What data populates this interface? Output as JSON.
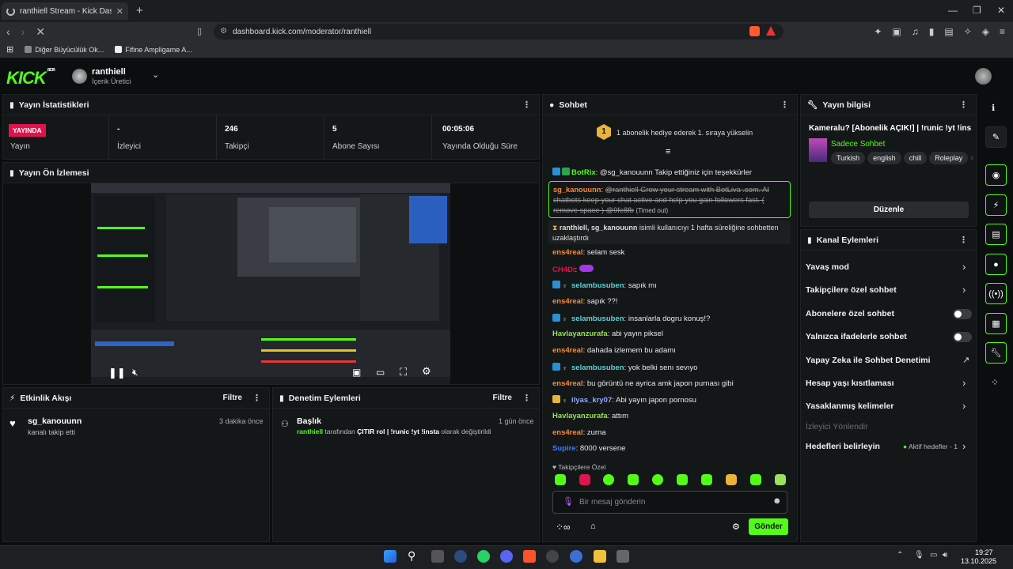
{
  "browser": {
    "tab_title": "ranthiell Stream - Kick Dashboard",
    "url": "dashboard.kick.com/moderator/ranthiell",
    "bookmarks": [
      "Diğer Büyücülük Ok...",
      "Fifine Ampligame A..."
    ]
  },
  "header": {
    "logo": "KICK",
    "logo_beta": "BETA",
    "user_name": "ranthiell",
    "user_role": "İçerik Üretici"
  },
  "stats": {
    "title": "Yayın İstatistikleri",
    "live_badge": "YAYINDA",
    "items": [
      {
        "value": "",
        "label": "Yayın"
      },
      {
        "value": "-",
        "label": "İzleyici"
      },
      {
        "value": "246",
        "label": "Takipçi"
      },
      {
        "value": "5",
        "label": "Abone Sayısı"
      },
      {
        "value": "00:05:06",
        "label": "Yayında Olduğu Süre"
      }
    ]
  },
  "preview": {
    "title": "Yayın Ön İzlemesi"
  },
  "activity": {
    "title": "Etkinlik Akışı",
    "filter": "Filtre",
    "items": [
      {
        "user": "sg_kanouunn",
        "text": "kanalı takip etti",
        "time": "3 dakika önce"
      }
    ]
  },
  "moderation": {
    "title": "Denetim Eylemleri",
    "filter": "Filtre",
    "items": [
      {
        "heading": "Başlık",
        "time": "1 gün önce",
        "actor": "ranthiell",
        "mid": "tarafından",
        "value": "ÇITIR rol | !runic !yt !insta",
        "suffix": "olarak değiştirildi"
      }
    ]
  },
  "chat": {
    "title": "Sohbet",
    "pinned": "1 abonelik hediye ederek 1. sıraya yükselin",
    "pinned_rank": "1",
    "messages": [
      {
        "name": "BotRix",
        "color": "#53fc18",
        "text": "@sg_kanouunn Takip ettiğiniz için teşekkürler"
      },
      {
        "name": "ens4real",
        "color": "#f28b3c",
        "text": "selam sesk"
      },
      {
        "name": "CH4Di",
        "color": "#e0134c",
        "text": ""
      },
      {
        "name": "selambusuben",
        "color": "#5fd0d6",
        "text": "sapık mı"
      },
      {
        "name": "ens4real",
        "color": "#f28b3c",
        "text": "sapık ??!"
      },
      {
        "name": "selambusuben",
        "color": "#5fd0d6",
        "text": "insanlarla dogru konuş!?"
      },
      {
        "name": "Havlayanzurafa",
        "color": "#9be15d",
        "text": "abi yayın piksel"
      },
      {
        "name": "ens4real",
        "color": "#f28b3c",
        "text": "dahada izlemem bu adamı"
      },
      {
        "name": "selambusuben",
        "color": "#5fd0d6",
        "text": "yok belki senı sevıyo"
      },
      {
        "name": "ens4real",
        "color": "#f28b3c",
        "text": "bu görüntü ne ayrica amk japon purnası gibi"
      },
      {
        "name": "ilyas_kry07",
        "color": "#8fa8ff",
        "text": "Abi yayın japon pornosu"
      },
      {
        "name": "Havlayanzurafa",
        "color": "#9be15d",
        "text": "attım"
      },
      {
        "name": "ens4real",
        "color": "#f28b3c",
        "text": "zurna"
      },
      {
        "name": "Supire",
        "color": "#3a7cff",
        "text": "8000 versene"
      }
    ],
    "removed": {
      "name": "sg_kanouunn",
      "text": "@ranthiell Grow your stream with BotLiva .com. AI chatbots keep your chat active and help you gain followers fast. ( remove space ) @9fe8fb",
      "tag": "(Timed out)"
    },
    "timeout": {
      "users": "ranthiell, sg_kanouunn",
      "text": "isimli kullanıcıyı 1 hafta süreliğine sohbetten uzaklaştırdı"
    },
    "followers_only": "Takipçilere Özel",
    "input_placeholder": "Bir mesaj gönderin",
    "send_label": "Gönder"
  },
  "stream_info": {
    "title": "Yayın bilgisi",
    "stream_title": "Kameralu? [Abonelik AÇIK!] | !runic !yt !insta",
    "category": "Sadece Sohbet",
    "tags": [
      "Turkish",
      "english",
      "chill",
      "Roleplay"
    ],
    "edit_label": "Düzenle"
  },
  "channel_actions": {
    "title": "Kanal Eylemleri",
    "slow_mode": "Yavaş mod",
    "followers_chat": "Takipçilere özel sohbet",
    "subscribers_chat": "Abonelere özel sohbet",
    "emote_only": "Yalnızca ifadelerle sohbet",
    "ai_moderation": "Yapay Zeka ile Sohbet Denetimi",
    "age_restriction": "Hesap yaşı kısıtlaması",
    "banned_words": "Yasaklanmış kelimeler",
    "viewer_direction": "İzleyici Yönlendir",
    "set_goals": "Hedefleri belirleyin",
    "goals_status": "Aktif hedefler - 1"
  },
  "taskbar": {
    "time": "19:27",
    "date": "13.10.2025"
  },
  "colors": {
    "accent": "#53fc18",
    "live": "#e0134c",
    "panel": "#141718"
  }
}
